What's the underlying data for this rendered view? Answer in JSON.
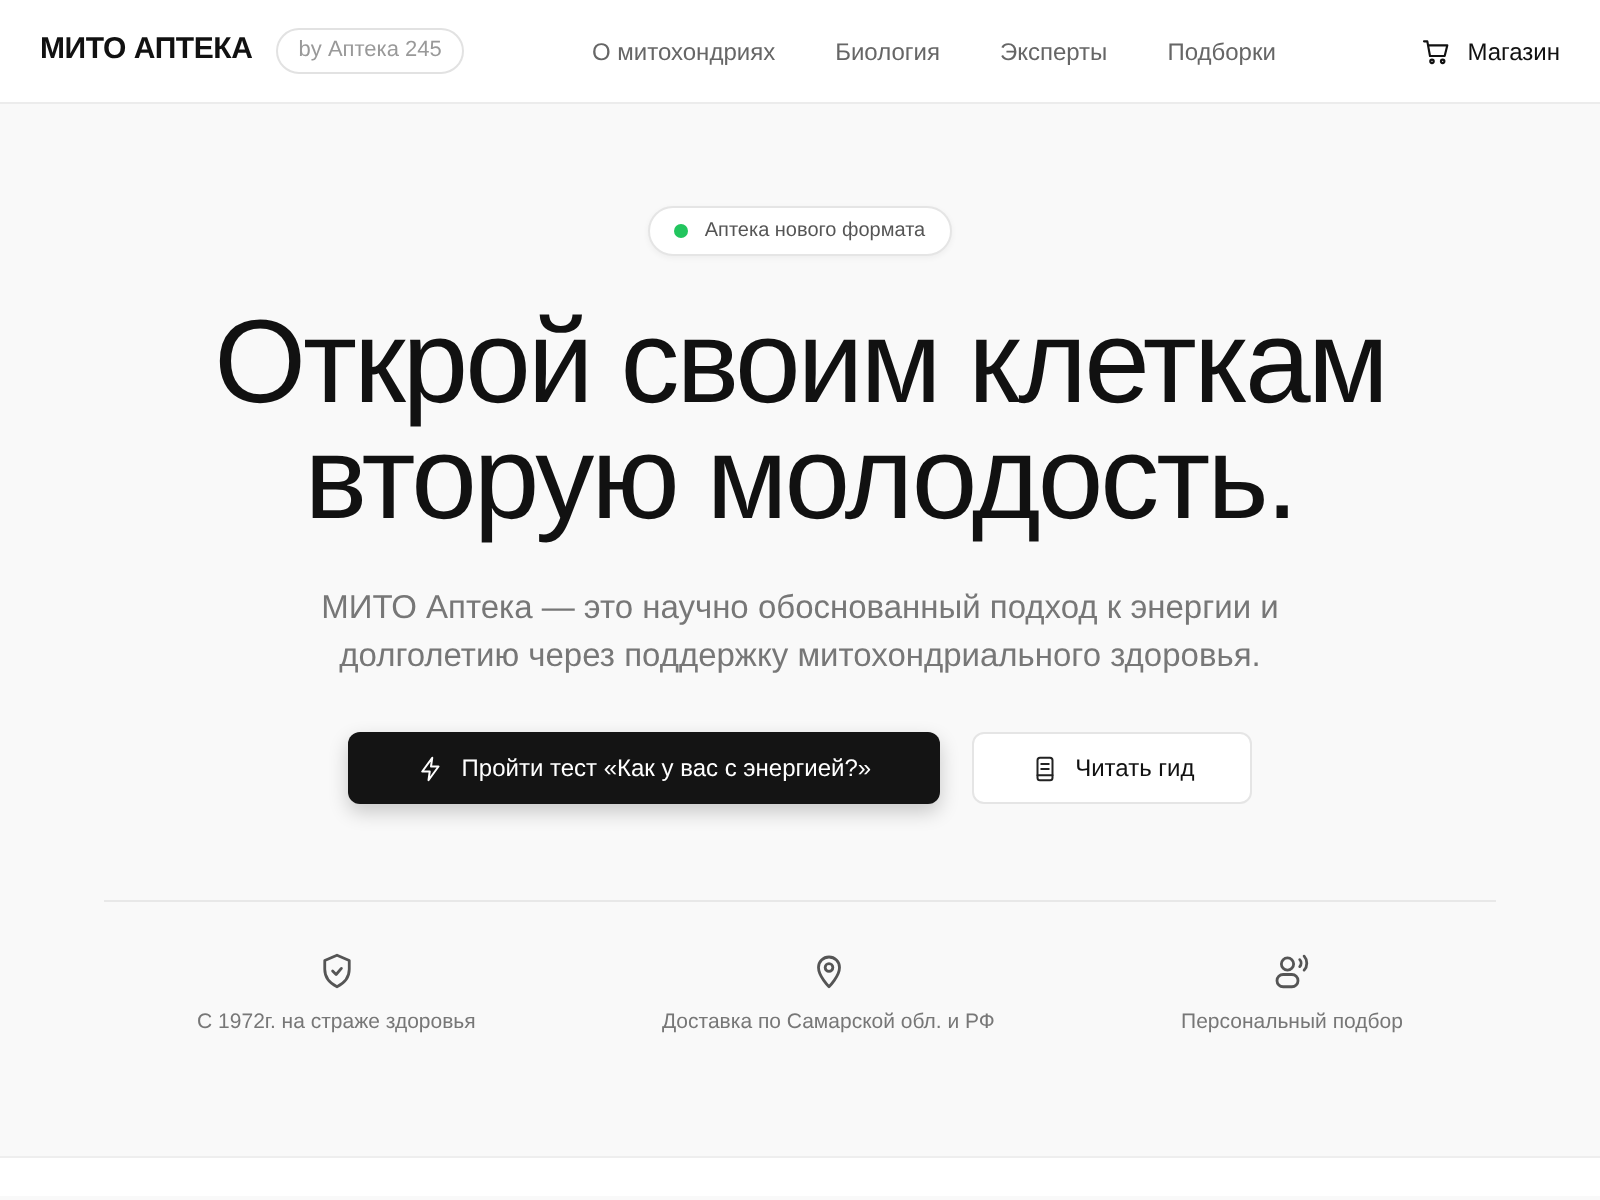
{
  "header": {
    "logo": "МИТО АПТЕКА",
    "tag": "by Аптека 245",
    "nav": [
      "О митохондриях",
      "Биология",
      "Эксперты",
      "Подборки"
    ],
    "shop": "Магазин"
  },
  "hero": {
    "badge": {
      "text": "Аптека нового формата",
      "color": "#22c55e"
    },
    "headline": [
      "Открой своим клеткам",
      "вторую молодость."
    ],
    "lead": "МИТО Аптека — это научно обоснованный подход к энергии и долголетию через поддержку митохондриального здоровья.",
    "buttons": [
      {
        "kind": "primary",
        "label": "Пройти тест «Как у вас с энергией?»"
      },
      {
        "kind": "secondary",
        "label": "Читать гид"
      }
    ]
  },
  "features": [
    {
      "text": "С 1972г. на страже здоровья"
    },
    {
      "text": "Доставка по Самарской обл. и РФ"
    },
    {
      "text": "Персональный подбор"
    }
  ]
}
